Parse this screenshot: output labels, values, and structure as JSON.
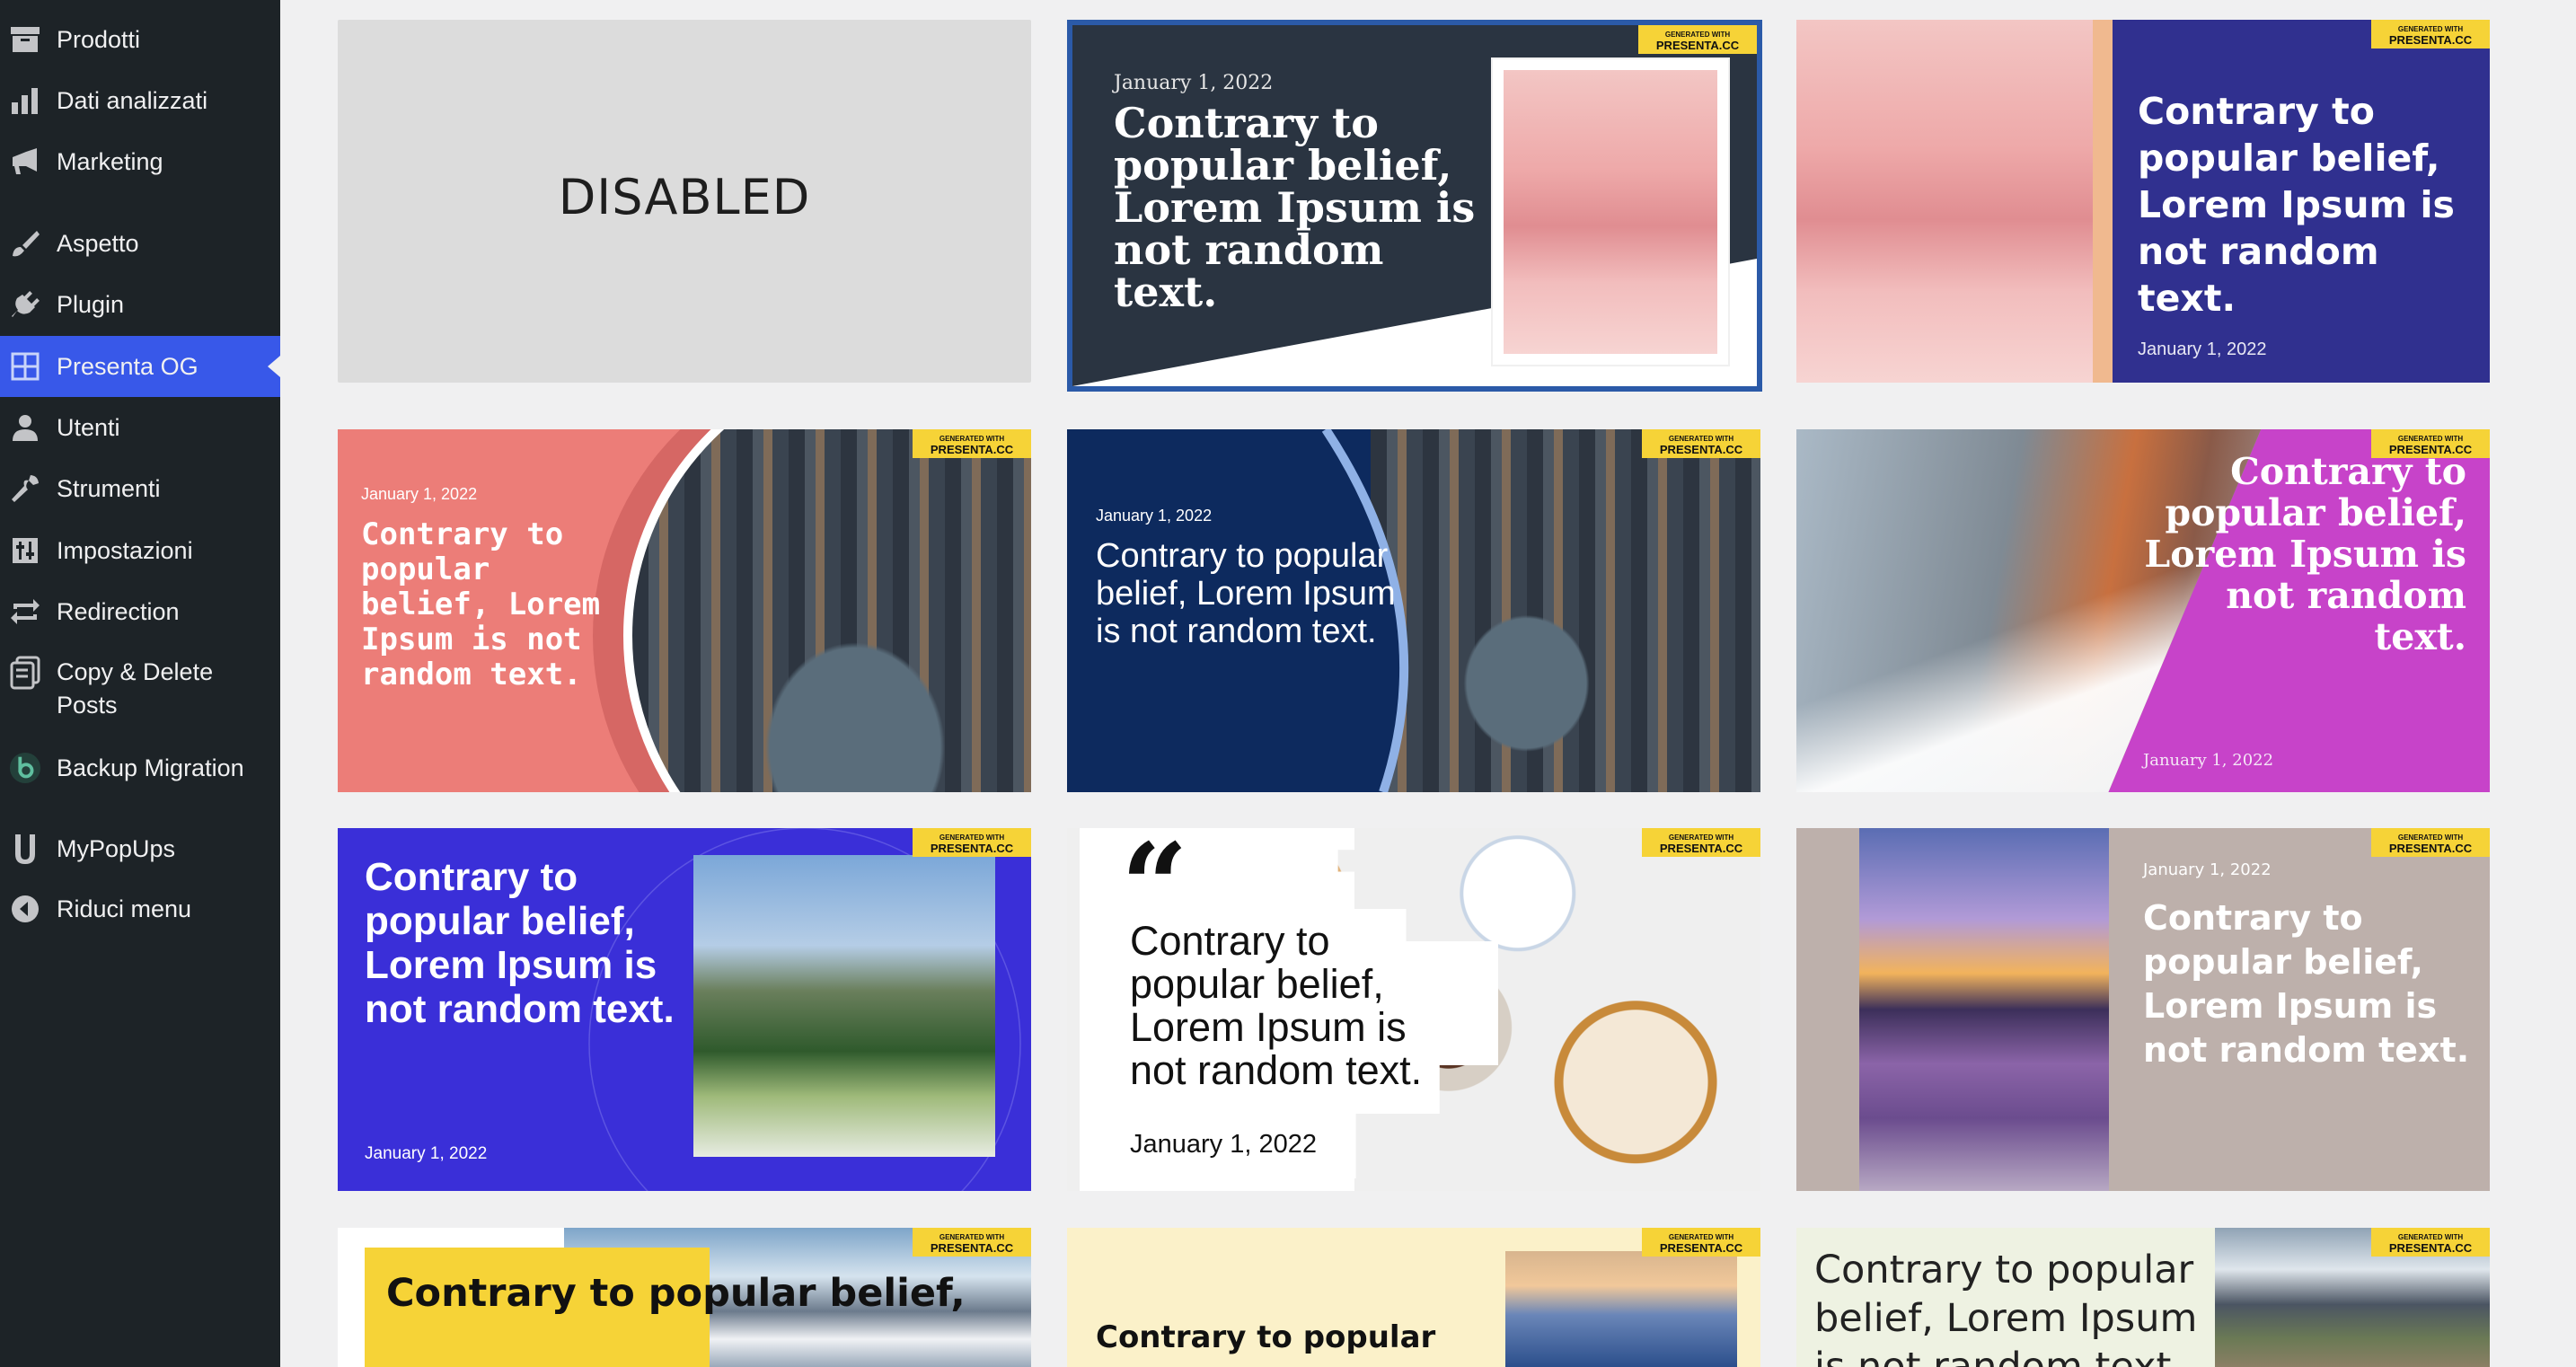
{
  "sidebar": {
    "items": [
      {
        "label": "Prodotti",
        "icon": "archive-icon"
      },
      {
        "label": "Dati analizzati",
        "icon": "bar-chart-icon"
      },
      {
        "label": "Marketing",
        "icon": "megaphone-icon"
      },
      {
        "label": "Aspetto",
        "icon": "paintbrush-icon"
      },
      {
        "label": "Plugin",
        "icon": "plugin-icon"
      },
      {
        "label": "Presenta OG",
        "icon": "grid-icon",
        "active": true
      },
      {
        "label": "Utenti",
        "icon": "user-icon"
      },
      {
        "label": "Strumenti",
        "icon": "wrench-icon"
      },
      {
        "label": "Impostazioni",
        "icon": "settings-sliders-icon"
      },
      {
        "label": "Redirection",
        "icon": "redirect-arrows-icon"
      },
      {
        "label": "Copy & Delete Posts",
        "label_line1": "Copy & Delete",
        "label_line2": "Posts",
        "icon": "copy-icon"
      },
      {
        "label": "Backup Migration",
        "icon": "backup-logo-icon"
      },
      {
        "label": "MyPopUps",
        "icon": "mypopups-logo-icon"
      },
      {
        "label": "Riduci menu",
        "icon": "collapse-arrow-icon"
      }
    ]
  },
  "badge": {
    "line1": "GENERATED WITH",
    "line2": "PRESENTA.CC"
  },
  "cards": {
    "disabled_label": "DISABLED",
    "date": "January 1, 2022",
    "text_period": "Contrary to popular belief, Lorem Ipsum is not random text.",
    "text_noperiod": "Contrary to popular belief, Lorem Ipsum is not random text.",
    "quote_mark": "“",
    "text_partial_1": "Contrary to popular belief,",
    "text_partial_2": "Contrary to popular",
    "text_partial_3": "Contrary to popular belief, Lorem Ipsum is not random text."
  },
  "colors": {
    "sidebar_bg": "#1d2327",
    "active_bg": "#3858e9",
    "badge_yellow": "#f6d337",
    "navy_card": "#0d2a5e",
    "indigo_card": "#30308f",
    "blue_card": "#3a2fd8",
    "coral_card": "#ec7d78",
    "magenta_card": "#c743c9",
    "taupe_card": "#bdb0ab"
  }
}
